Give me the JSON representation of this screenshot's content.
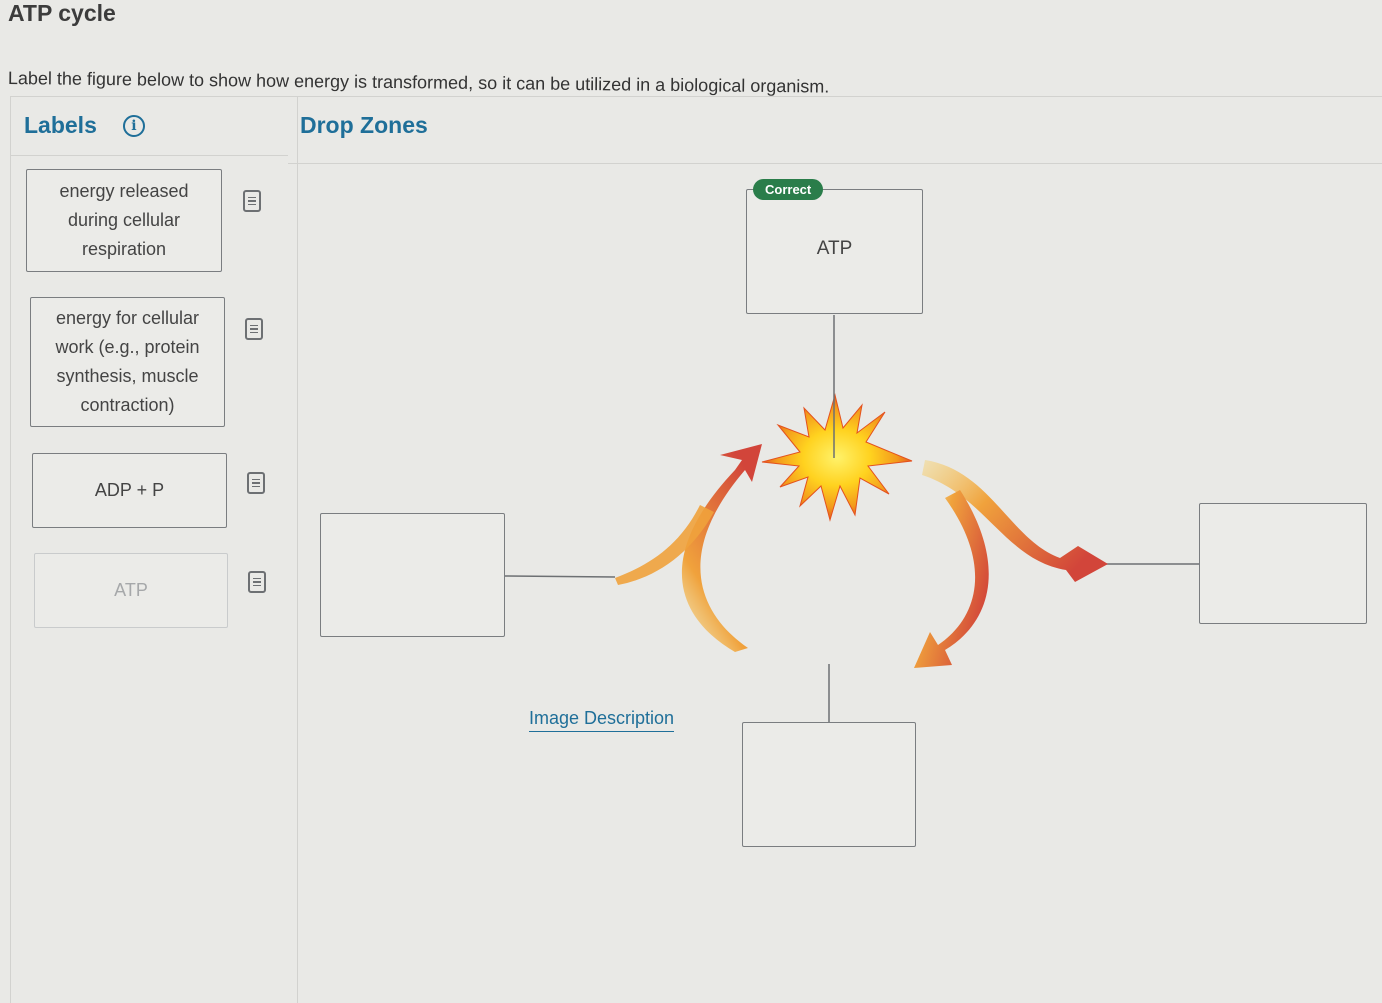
{
  "header": {
    "title": "ATP cycle",
    "instructions": "Label the figure below to show how energy is transformed, so it can be utilized in a biological organism."
  },
  "labels_panel": {
    "heading": "Labels",
    "info_icon": "info-icon",
    "items": [
      {
        "lines": [
          "energy released",
          "during cellular",
          "respiration"
        ],
        "used": false
      },
      {
        "lines": [
          "energy for cellular",
          "work (e.g., protein",
          "synthesis, muscle",
          "contraction)"
        ],
        "used": false
      },
      {
        "lines": [
          "ADP + P"
        ],
        "used": false
      },
      {
        "lines": [
          "ATP"
        ],
        "used": true
      }
    ]
  },
  "drop_panel": {
    "heading": "Drop Zones",
    "zones": [
      {
        "id": "top",
        "value": "ATP",
        "status": "Correct"
      },
      {
        "id": "left",
        "value": ""
      },
      {
        "id": "right",
        "value": ""
      },
      {
        "id": "bottom",
        "value": ""
      }
    ],
    "image_description_link": "Image Description"
  },
  "colors": {
    "accent": "#1f6f99",
    "correct": "#2a7d4a",
    "arrow_red": "#d2453a",
    "arrow_yellow": "#f3c44a"
  }
}
